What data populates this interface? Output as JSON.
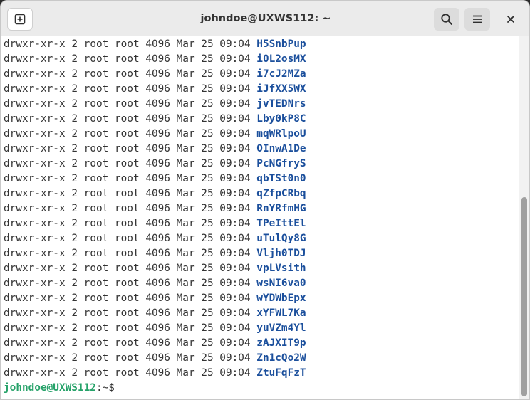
{
  "window": {
    "title": "johndoe@UXWS112: ~"
  },
  "icons": {
    "new_tab": "new-tab-plus-icon",
    "search": "search-icon",
    "menu": "hamburger-menu-icon",
    "close": "close-icon"
  },
  "colors": {
    "titlebar": "#ebebeb",
    "terminal_bg": "#ffffff",
    "directory": "#1b4f9c",
    "prompt_user": "#26a269",
    "text": "#333333"
  },
  "terminal": {
    "lines": [
      {
        "perm": "drwxr-xr-x",
        "links": "2",
        "owner": "root",
        "group": "root",
        "size": "4096",
        "date": "Mar 25 09:04",
        "name": "H5SnbPup"
      },
      {
        "perm": "drwxr-xr-x",
        "links": "2",
        "owner": "root",
        "group": "root",
        "size": "4096",
        "date": "Mar 25 09:04",
        "name": "i0L2osMX"
      },
      {
        "perm": "drwxr-xr-x",
        "links": "2",
        "owner": "root",
        "group": "root",
        "size": "4096",
        "date": "Mar 25 09:04",
        "name": "i7cJ2MZa"
      },
      {
        "perm": "drwxr-xr-x",
        "links": "2",
        "owner": "root",
        "group": "root",
        "size": "4096",
        "date": "Mar 25 09:04",
        "name": "iJfXX5WX"
      },
      {
        "perm": "drwxr-xr-x",
        "links": "2",
        "owner": "root",
        "group": "root",
        "size": "4096",
        "date": "Mar 25 09:04",
        "name": "jvTEDNrs"
      },
      {
        "perm": "drwxr-xr-x",
        "links": "2",
        "owner": "root",
        "group": "root",
        "size": "4096",
        "date": "Mar 25 09:04",
        "name": "Lby0kP8C"
      },
      {
        "perm": "drwxr-xr-x",
        "links": "2",
        "owner": "root",
        "group": "root",
        "size": "4096",
        "date": "Mar 25 09:04",
        "name": "mqWRlpoU"
      },
      {
        "perm": "drwxr-xr-x",
        "links": "2",
        "owner": "root",
        "group": "root",
        "size": "4096",
        "date": "Mar 25 09:04",
        "name": "OInwA1De"
      },
      {
        "perm": "drwxr-xr-x",
        "links": "2",
        "owner": "root",
        "group": "root",
        "size": "4096",
        "date": "Mar 25 09:04",
        "name": "PcNGfryS"
      },
      {
        "perm": "drwxr-xr-x",
        "links": "2",
        "owner": "root",
        "group": "root",
        "size": "4096",
        "date": "Mar 25 09:04",
        "name": "qbTSt0n0"
      },
      {
        "perm": "drwxr-xr-x",
        "links": "2",
        "owner": "root",
        "group": "root",
        "size": "4096",
        "date": "Mar 25 09:04",
        "name": "qZfpCRbq"
      },
      {
        "perm": "drwxr-xr-x",
        "links": "2",
        "owner": "root",
        "group": "root",
        "size": "4096",
        "date": "Mar 25 09:04",
        "name": "RnYRfmHG"
      },
      {
        "perm": "drwxr-xr-x",
        "links": "2",
        "owner": "root",
        "group": "root",
        "size": "4096",
        "date": "Mar 25 09:04",
        "name": "TPeIttEl"
      },
      {
        "perm": "drwxr-xr-x",
        "links": "2",
        "owner": "root",
        "group": "root",
        "size": "4096",
        "date": "Mar 25 09:04",
        "name": "uTulQy8G"
      },
      {
        "perm": "drwxr-xr-x",
        "links": "2",
        "owner": "root",
        "group": "root",
        "size": "4096",
        "date": "Mar 25 09:04",
        "name": "Vljh0TDJ"
      },
      {
        "perm": "drwxr-xr-x",
        "links": "2",
        "owner": "root",
        "group": "root",
        "size": "4096",
        "date": "Mar 25 09:04",
        "name": "vpLVsith"
      },
      {
        "perm": "drwxr-xr-x",
        "links": "2",
        "owner": "root",
        "group": "root",
        "size": "4096",
        "date": "Mar 25 09:04",
        "name": "wsNI6va0"
      },
      {
        "perm": "drwxr-xr-x",
        "links": "2",
        "owner": "root",
        "group": "root",
        "size": "4096",
        "date": "Mar 25 09:04",
        "name": "wYDWbEpx"
      },
      {
        "perm": "drwxr-xr-x",
        "links": "2",
        "owner": "root",
        "group": "root",
        "size": "4096",
        "date": "Mar 25 09:04",
        "name": "xYFWL7Ka"
      },
      {
        "perm": "drwxr-xr-x",
        "links": "2",
        "owner": "root",
        "group": "root",
        "size": "4096",
        "date": "Mar 25 09:04",
        "name": "yuVZm4Yl"
      },
      {
        "perm": "drwxr-xr-x",
        "links": "2",
        "owner": "root",
        "group": "root",
        "size": "4096",
        "date": "Mar 25 09:04",
        "name": "zAJXIT9p"
      },
      {
        "perm": "drwxr-xr-x",
        "links": "2",
        "owner": "root",
        "group": "root",
        "size": "4096",
        "date": "Mar 25 09:04",
        "name": "Zn1cQo2W"
      },
      {
        "perm": "drwxr-xr-x",
        "links": "2",
        "owner": "root",
        "group": "root",
        "size": "4096",
        "date": "Mar 25 09:04",
        "name": "ZtuFqFzT"
      }
    ],
    "prompt": {
      "user_host": "johndoe@UXWS112",
      "path": ":~$"
    }
  }
}
